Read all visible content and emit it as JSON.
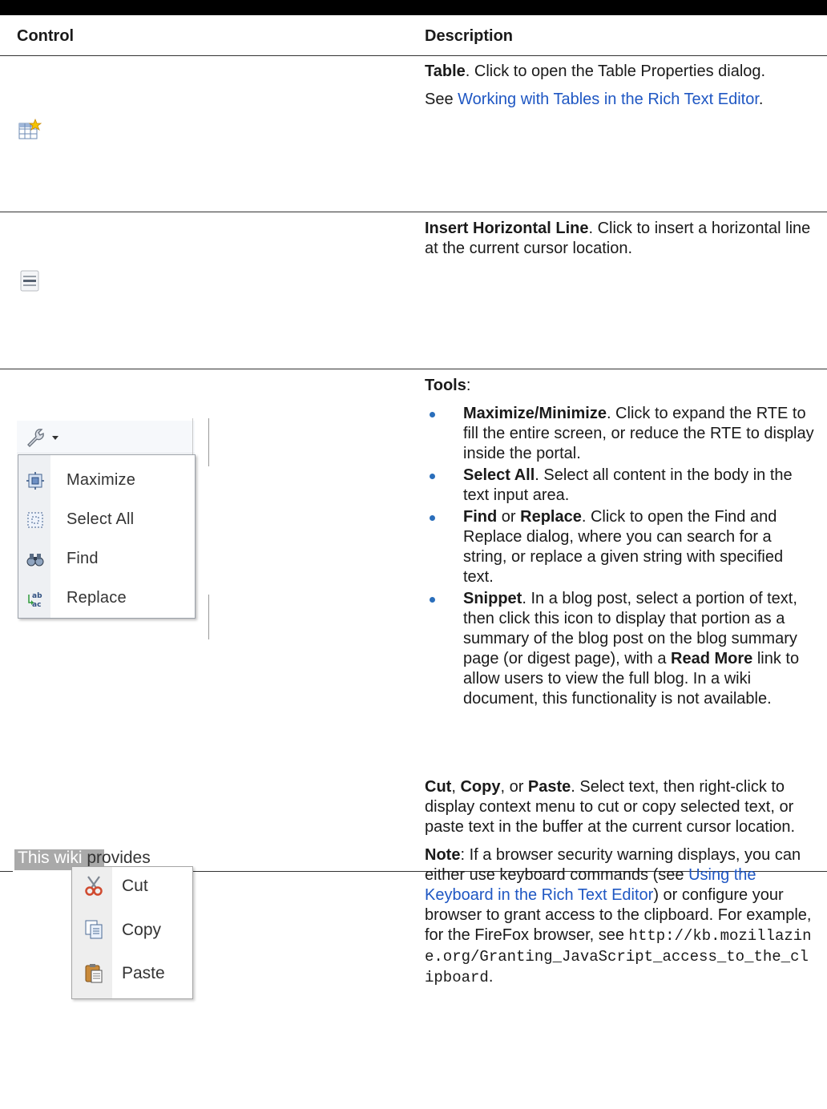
{
  "header": {
    "col_control": "Control",
    "col_description": "Description"
  },
  "rows": {
    "table": {
      "icon": "table-properties-icon",
      "title": "Table",
      "text": ". Click to open the Table Properties dialog.",
      "see": "See ",
      "link": "Working with Tables in the Rich Text Editor",
      "end": "."
    },
    "hr": {
      "icon": "horizontal-line-icon",
      "title": "Insert Horizontal Line",
      "text": ". Click to insert a horizontal line at the current cursor location."
    },
    "tools": {
      "title": "Tools",
      "colon": ":",
      "menu": {
        "button_icon": "wrench-icon",
        "items": [
          {
            "label": "Maximize",
            "icon": "maximize-icon"
          },
          {
            "label": "Select All",
            "icon": "select-all-icon"
          },
          {
            "label": "Find",
            "icon": "binoculars-icon"
          },
          {
            "label": "Replace",
            "icon": "replace-icon"
          }
        ]
      },
      "bullets": [
        {
          "b": "Maximize/Minimize",
          "t": ". Click to expand the RTE to fill the entire screen, or reduce the RTE to display inside the portal."
        },
        {
          "b": "Select All",
          "t": ". Select all content in the body in the text input area."
        },
        {
          "b1": "Find",
          "m": " or ",
          "b2": "Replace",
          "t": ". Click to open the Find and Replace dialog, where you can search for a string, or replace a given string with specified text."
        },
        {
          "b": "Snippet",
          "t": ". In a blog post, select a portion of text, then click this icon to display that portion as a summary of the blog post on the blog summary page (or digest page), with a ",
          "b3": "Read More",
          "t2": " link to allow users to view the full blog. In a wiki document, this functionality is not available."
        }
      ]
    },
    "clipboard": {
      "sample": {
        "selected": "This wiki",
        "rest": " provides"
      },
      "menu": [
        {
          "label": "Cut",
          "icon": "scissors-icon"
        },
        {
          "label": "Copy",
          "icon": "copy-icon"
        },
        {
          "label": "Paste",
          "icon": "paste-icon"
        }
      ],
      "b_cut": "Cut",
      "sep1": ", ",
      "b_copy": "Copy",
      "sep2": ", or ",
      "b_paste": "Paste",
      "text": ". Select text, then right-click to display context menu to cut or copy selected text, or paste text in the buffer at the current cursor location.",
      "note_label": "Note",
      "note_text": ": If a browser security warning displays, you can either use keyboard commands (see ",
      "note_link": "Using the Keyboard in the Rich Text Editor",
      "note_text2": ") or configure your browser to grant access to the clipboard. For example, for the FireFox browser, see ",
      "url": "http://kb.mozillazine.org/Granting_JavaScript_access_to_the_clipboard",
      "end": "."
    }
  }
}
